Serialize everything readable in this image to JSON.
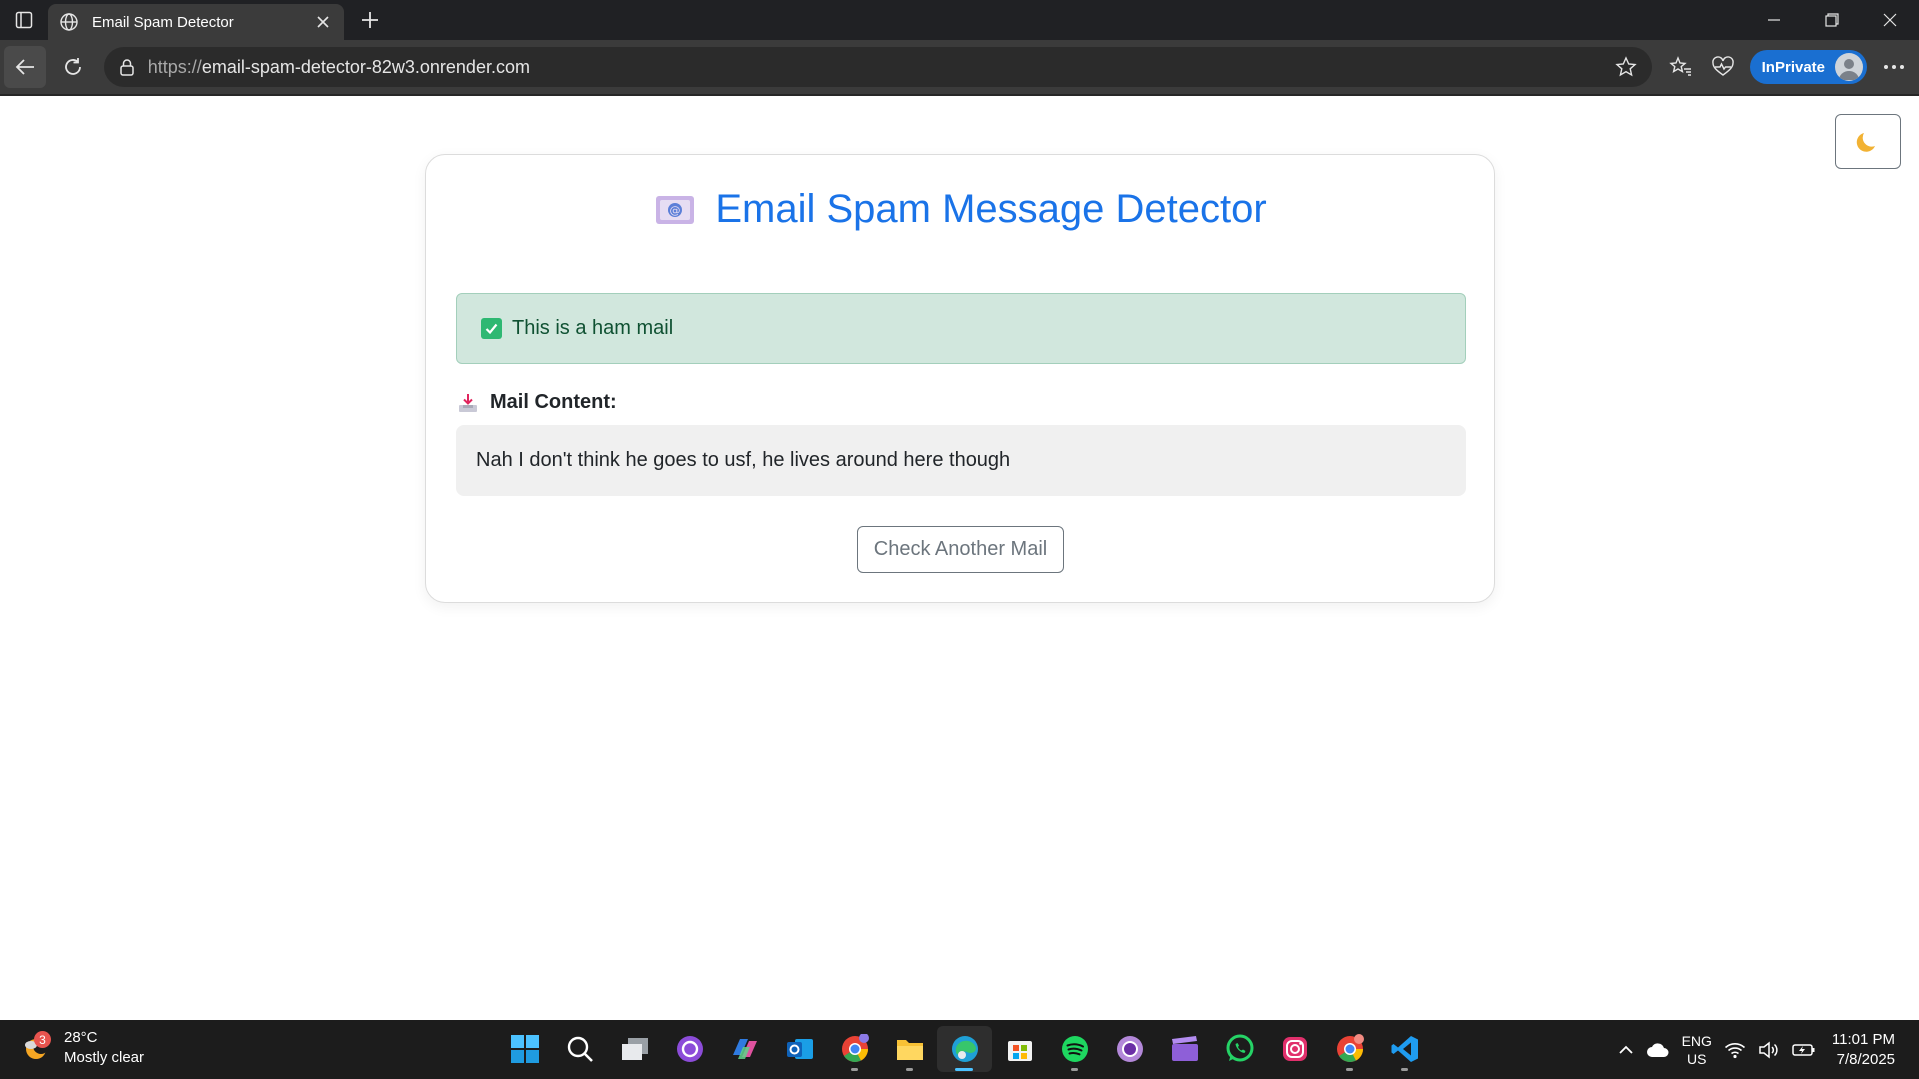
{
  "browser": {
    "tab_title": "Email Spam Detector",
    "url_prefix": "https://",
    "url_domain": "email-spam-detector-82w3.onrender.com",
    "inprivate_label": "InPrivate"
  },
  "page": {
    "title": "Email Spam Message Detector",
    "result_text": "This is a ham mail",
    "content_label": "Mail Content:",
    "mail_content": "Nah I don't think he goes to usf, he lives around here though",
    "check_another_label": "Check Another Mail",
    "theme_toggle_icon": "moon-icon"
  },
  "taskbar": {
    "weather_temp": "28°C",
    "weather_desc": "Mostly clear",
    "weather_badge": "3",
    "lang_line1": "ENG",
    "lang_line2": "US",
    "time": "11:01 PM",
    "date": "7/8/2025",
    "icons": [
      "start-icon",
      "search-icon",
      "task-view-icon",
      "github-desktop-icon",
      "m365-icon",
      "outlook-icon",
      "chrome-icon",
      "file-explorer-icon",
      "edge-icon",
      "microsoft-store-icon",
      "spotify-icon",
      "circle-app-icon",
      "clapperboard-icon",
      "whatsapp-icon",
      "instagram-icon",
      "chrome-canary-icon",
      "vscode-icon"
    ]
  },
  "colors": {
    "title_blue": "#1a73e8",
    "success_bg": "#d1e7dd",
    "success_text": "#0f5132",
    "content_bg": "#f0f0f0"
  }
}
